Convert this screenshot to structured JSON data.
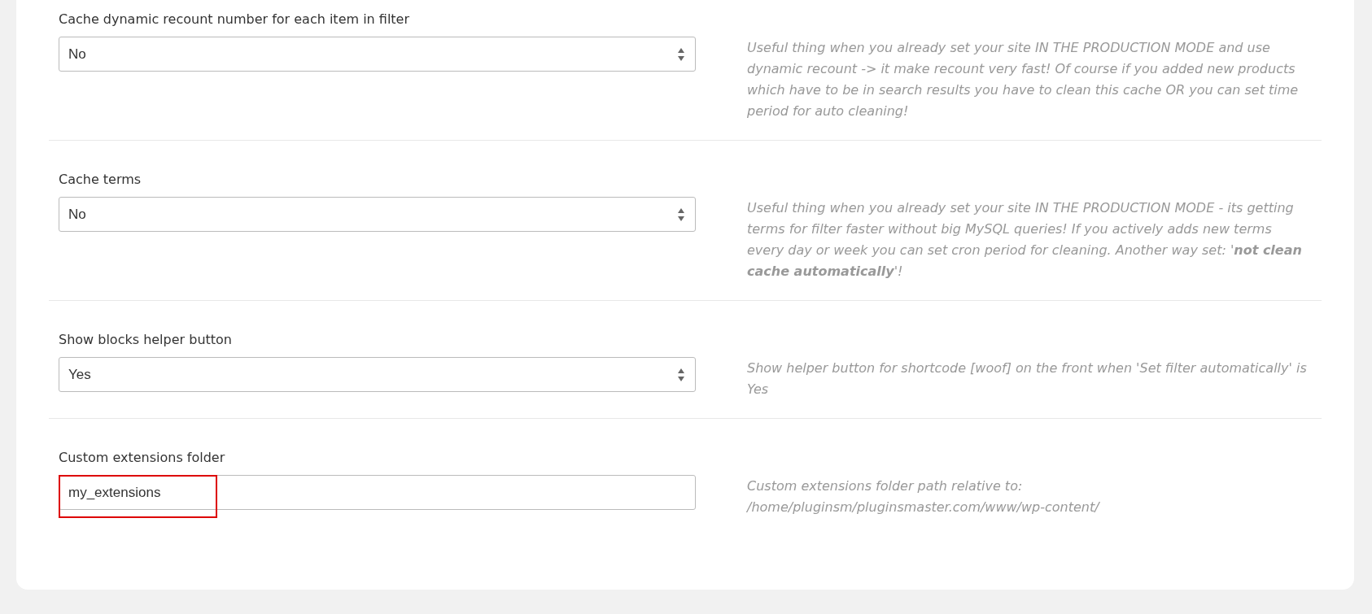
{
  "settings": [
    {
      "kind": "select",
      "label": "Cache dynamic recount number for each item in filter",
      "value": "No",
      "help": "Useful thing when you already set your site IN THE PRODUCTION MODE and use dynamic recount -> it make recount very fast! Of course if you added new products which have to be in search results you have to clean this cache OR you can set time period for auto cleaning!"
    },
    {
      "kind": "select",
      "label": "Cache terms",
      "value": "No",
      "help": "Useful thing when you already set your site IN THE PRODUCTION MODE - its getting terms for filter faster without big MySQL queries! If you actively adds new terms every day or week you can set cron period for cleaning. Another way set: '**not clean cache automatically**'!"
    },
    {
      "kind": "select",
      "label": "Show blocks helper button",
      "value": "Yes",
      "help": "Show helper button for shortcode [woof] on the front when 'Set filter automatically' is Yes"
    },
    {
      "kind": "text",
      "label": "Custom extensions folder",
      "value": "my_extensions",
      "highlighted": true,
      "help": "Custom extensions folder path relative to: /home/pluginsm/pluginsmaster.com/www/wp-content/"
    }
  ]
}
